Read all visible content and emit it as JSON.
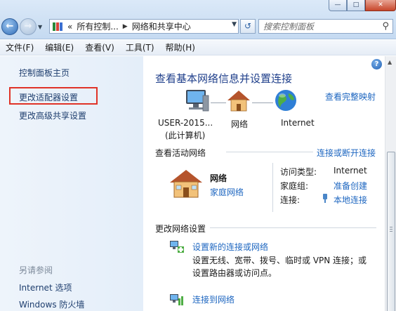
{
  "window": {
    "min": "—",
    "max": "□",
    "close": "✕"
  },
  "address": {
    "crumbs": [
      "所有控制...",
      "网络和共享中心"
    ],
    "prefix": "«",
    "separator": "▶",
    "search_placeholder": "搜索控制面板"
  },
  "menu": [
    "文件(F)",
    "编辑(E)",
    "查看(V)",
    "工具(T)",
    "帮助(H)"
  ],
  "sidebar": {
    "items": [
      "控制面板主页",
      "更改适配器设置",
      "更改高级共享设置"
    ],
    "see_also_title": "另请参阅",
    "see_also": [
      "Internet 选项",
      "Windows 防火墙"
    ]
  },
  "main": {
    "heading": "查看基本网络信息并设置连接",
    "full_map": "查看完整映射",
    "nodes": [
      {
        "label": "USER-2015...",
        "sublabel": "(此计算机)"
      },
      {
        "label": "网络"
      },
      {
        "label": "Internet"
      }
    ],
    "active_networks_title": "查看活动网络",
    "connect_disconnect": "连接或断开连接",
    "network": {
      "name": "网络",
      "type": "家庭网络",
      "access_type_label": "访问类型:",
      "access_type_value": "Internet",
      "homegroup_label": "家庭组:",
      "homegroup_value": "准备创建",
      "connection_label": "连接:",
      "connection_value": "本地连接"
    },
    "change_settings_title": "更改网络设置",
    "tasks": [
      {
        "title": "设置新的连接或网络",
        "desc": [
          "设置无线、宽带、拨号、临时或 VPN 连接；或",
          "设置路由器或访问点。"
        ]
      },
      {
        "title": "连接到网络"
      }
    ]
  },
  "colors": {
    "link": "#1d66c0",
    "heading": "#1f3f8b",
    "highlight": "#e03327"
  }
}
